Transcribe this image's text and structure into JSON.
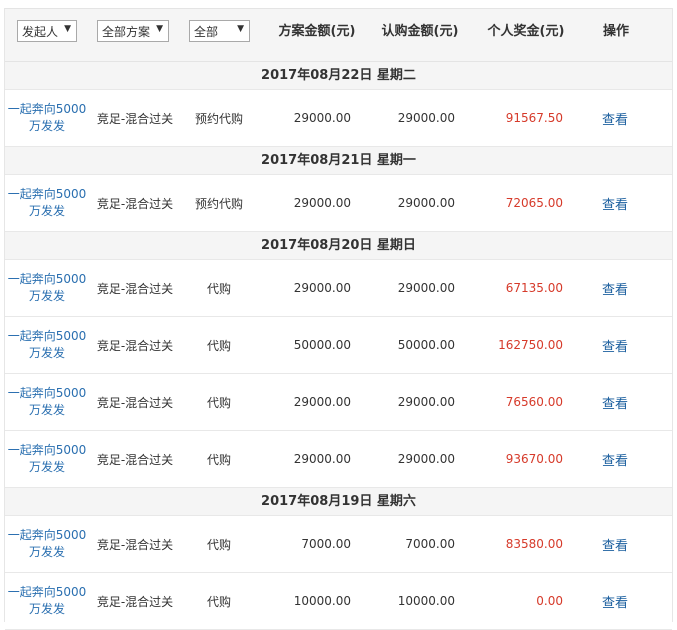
{
  "header": {
    "filter_initiator": "发起人",
    "filter_plan": "全部方案",
    "filter_status": "全部",
    "col_amount": "方案金额(元)",
    "col_subscribed": "认购金额(元)",
    "col_prize": "个人奖金(元)",
    "col_action": "操作"
  },
  "groups": [
    {
      "date": "2017年08月22日 星期二",
      "rows": [
        {
          "initiator": "一起奔向5000万发发",
          "type": "竞足-混合过关",
          "mode": "预约代购",
          "amount": "29000.00",
          "subscribed": "29000.00",
          "prize": "91567.50",
          "action": "查看"
        }
      ]
    },
    {
      "date": "2017年08月21日 星期一",
      "rows": [
        {
          "initiator": "一起奔向5000万发发",
          "type": "竞足-混合过关",
          "mode": "预约代购",
          "amount": "29000.00",
          "subscribed": "29000.00",
          "prize": "72065.00",
          "action": "查看"
        }
      ]
    },
    {
      "date": "2017年08月20日 星期日",
      "rows": [
        {
          "initiator": "一起奔向5000万发发",
          "type": "竞足-混合过关",
          "mode": "代购",
          "amount": "29000.00",
          "subscribed": "29000.00",
          "prize": "67135.00",
          "action": "查看"
        },
        {
          "initiator": "一起奔向5000万发发",
          "type": "竞足-混合过关",
          "mode": "代购",
          "amount": "50000.00",
          "subscribed": "50000.00",
          "prize": "162750.00",
          "action": "查看"
        },
        {
          "initiator": "一起奔向5000万发发",
          "type": "竞足-混合过关",
          "mode": "代购",
          "amount": "29000.00",
          "subscribed": "29000.00",
          "prize": "76560.00",
          "action": "查看"
        },
        {
          "initiator": "一起奔向5000万发发",
          "type": "竞足-混合过关",
          "mode": "代购",
          "amount": "29000.00",
          "subscribed": "29000.00",
          "prize": "93670.00",
          "action": "查看"
        }
      ]
    },
    {
      "date": "2017年08月19日 星期六",
      "rows": [
        {
          "initiator": "一起奔向5000万发发",
          "type": "竞足-混合过关",
          "mode": "代购",
          "amount": "7000.00",
          "subscribed": "7000.00",
          "prize": "83580.00",
          "action": "查看"
        },
        {
          "initiator": "一起奔向5000万发发",
          "type": "竞足-混合过关",
          "mode": "代购",
          "amount": "10000.00",
          "subscribed": "10000.00",
          "prize": "0.00",
          "action": "查看"
        }
      ]
    }
  ],
  "colors": {
    "link": "#2a6fb0",
    "prize": "#d63a2a",
    "action": "#1a5e9e"
  }
}
